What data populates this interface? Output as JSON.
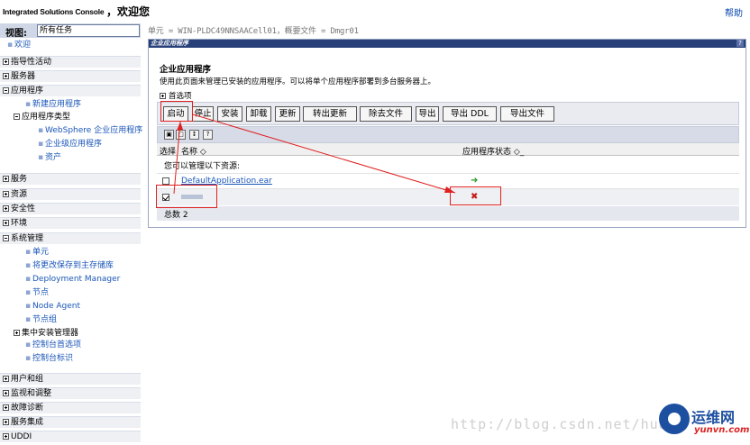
{
  "header": {
    "brand": "Integrated Solutions Console",
    "welcome": "，欢迎您",
    "help_link": "帮助"
  },
  "sidebar": {
    "view_label": "视图:",
    "view_value": "所有任务",
    "items": [
      {
        "label": "欢迎",
        "type": "link"
      },
      {
        "label": "指导性活动",
        "type": "section"
      },
      {
        "label": "服务器",
        "type": "section"
      },
      {
        "label": "应用程序",
        "type": "section"
      },
      {
        "label": "新建应用程序",
        "type": "link"
      },
      {
        "label": "应用程序类型",
        "type": "subsection"
      },
      {
        "label": "WebSphere 企业应用程序",
        "type": "link"
      },
      {
        "label": "企业级应用程序",
        "type": "link"
      },
      {
        "label": "资产",
        "type": "link"
      },
      {
        "label": "服务",
        "type": "section"
      },
      {
        "label": "资源",
        "type": "section"
      },
      {
        "label": "安全性",
        "type": "section"
      },
      {
        "label": "环境",
        "type": "section"
      },
      {
        "label": "系统管理",
        "type": "section"
      },
      {
        "label": "单元",
        "type": "link"
      },
      {
        "label": "将更改保存到主存储库",
        "type": "link"
      },
      {
        "label": "Deployment Manager",
        "type": "link"
      },
      {
        "label": "节点",
        "type": "link"
      },
      {
        "label": "Node Agent",
        "type": "link"
      },
      {
        "label": "节点组",
        "type": "link"
      },
      {
        "label": "集中安装管理器",
        "type": "subsection"
      },
      {
        "label": "控制台首选项",
        "type": "link"
      },
      {
        "label": "控制台标识",
        "type": "link"
      },
      {
        "label": "用户和组",
        "type": "section"
      },
      {
        "label": "监视和调整",
        "type": "section"
      },
      {
        "label": "故障诊断",
        "type": "section"
      },
      {
        "label": "服务集成",
        "type": "section"
      },
      {
        "label": "UDDI",
        "type": "section"
      }
    ]
  },
  "main": {
    "breadcrumb": "单元 = WIN-PLDC49NNSAACell01，概要文件 = Dmgr01",
    "panel_title": "企业应用程序",
    "panel_help": "?",
    "heading": "企业应用程序",
    "description": "使用此页面来管理已安装的应用程序。可以将单个应用程序部署到多台服务器上。",
    "preferences": "首选项",
    "buttons": [
      "启动",
      "停止",
      "安装",
      "卸载",
      "更新",
      "转出更新",
      "除去文件",
      "导出",
      "导出 DDL",
      "导出文件"
    ],
    "table": {
      "col_select": "选择",
      "col_name": "名称 ◇",
      "col_status": "应用程序状态 ◇_",
      "resource_note": "您可以管理以下资源:",
      "rows": [
        {
          "name": "DefaultApplication.ear",
          "checked": false,
          "status": "running"
        },
        {
          "name": "",
          "checked": true,
          "status": "stopped"
        }
      ],
      "total": "总数 2"
    }
  },
  "watermark": {
    "url": "http://blog.csdn.net/hua",
    "logo_cn": "运维网",
    "logo_en": "yunvn.com"
  },
  "colors": {
    "title_bar": "#27407a",
    "link": "#1a56b8",
    "highlight": "#e02020",
    "running": "#2a9b2a",
    "stopped": "#c81818"
  }
}
